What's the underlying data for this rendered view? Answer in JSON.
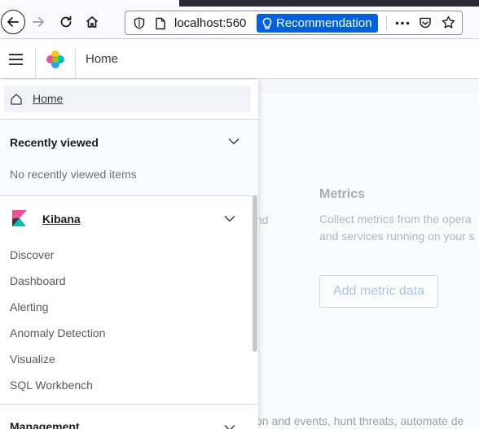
{
  "browser": {
    "url_host": "localhost:560",
    "recommendation_label": "Recommendation",
    "icons": [
      "back-arrow-icon",
      "forward-arrow-icon",
      "reload-icon",
      "home-icon",
      "shield-icon",
      "page-icon",
      "lightbulb-icon",
      "more-icon",
      "pocket-icon",
      "star-icon"
    ]
  },
  "header": {
    "breadcrumb": "Home"
  },
  "nav": {
    "home_label": "Home",
    "recent": {
      "title": "Recently viewed",
      "empty_text": "No recently viewed items"
    },
    "kibana": {
      "title": "Kibana",
      "items": [
        "Discover",
        "Dashboard",
        "Alerting",
        "Anomaly Detection",
        "Visualize",
        "SQL Workbench"
      ]
    },
    "management": {
      "title": "Management"
    }
  },
  "background": {
    "metrics_title": "Metrics",
    "metrics_desc_line1": "Collect metrics from the opera",
    "metrics_desc_line2": "and services running on your s",
    "ghost_fragment": "nd",
    "add_metric_button": "Add metric data",
    "bottom_text": "on and events, hunt threats, automate de"
  },
  "colors": {
    "accent_blue": "#0061e0",
    "kibana_pink": "#f04e98",
    "kibana_teal": "#00bfb3",
    "elastic_yellow": "#fec514"
  }
}
